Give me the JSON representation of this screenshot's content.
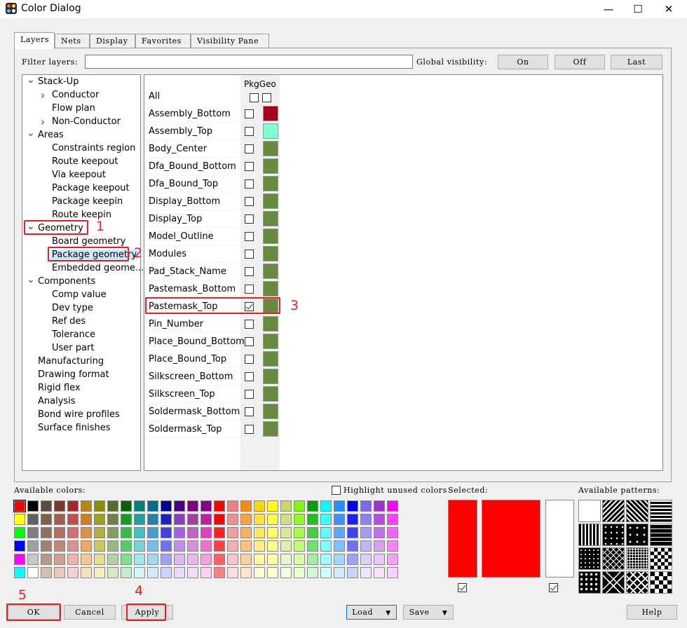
{
  "window": {
    "title": "Color Dialog",
    "min": "—",
    "max": "☐",
    "close": "✕"
  },
  "tabs": [
    "Layers",
    "Nets",
    "Display",
    "Favorites",
    "Visibility Pane"
  ],
  "filter": {
    "label": "Filter layers:",
    "value": ""
  },
  "global_visibility": {
    "label": "Global visibility:",
    "on": "On",
    "off": "Off",
    "last": "Last"
  },
  "tree": [
    {
      "label": "Stack-Up",
      "level": 0,
      "exp": "down"
    },
    {
      "label": "Conductor",
      "level": 1,
      "exp": "right"
    },
    {
      "label": "Flow plan",
      "level": 1,
      "exp": ""
    },
    {
      "label": "Non-Conductor",
      "level": 1,
      "exp": "right"
    },
    {
      "label": "Areas",
      "level": 0,
      "exp": "down"
    },
    {
      "label": "Constraints region",
      "level": 1,
      "exp": ""
    },
    {
      "label": "Route keepout",
      "level": 1,
      "exp": ""
    },
    {
      "label": "Via keepout",
      "level": 1,
      "exp": ""
    },
    {
      "label": "Package keepout",
      "level": 1,
      "exp": ""
    },
    {
      "label": "Package keepin",
      "level": 1,
      "exp": ""
    },
    {
      "label": "Route keepin",
      "level": 1,
      "exp": ""
    },
    {
      "label": "Geometry",
      "level": 0,
      "exp": "down"
    },
    {
      "label": "Board geometry",
      "level": 1,
      "exp": ""
    },
    {
      "label": "Package geometry",
      "level": 1,
      "exp": "",
      "selected": true
    },
    {
      "label": "Embedded geome...",
      "level": 1,
      "exp": ""
    },
    {
      "label": "Components",
      "level": 0,
      "exp": "down"
    },
    {
      "label": "Comp value",
      "level": 1,
      "exp": ""
    },
    {
      "label": "Dev type",
      "level": 1,
      "exp": ""
    },
    {
      "label": "Ref des",
      "level": 1,
      "exp": ""
    },
    {
      "label": "Tolerance",
      "level": 1,
      "exp": ""
    },
    {
      "label": "User part",
      "level": 1,
      "exp": ""
    },
    {
      "label": "Manufacturing",
      "level": 0,
      "exp": ""
    },
    {
      "label": "Drawing format",
      "level": 0,
      "exp": ""
    },
    {
      "label": "Rigid flex",
      "level": 0,
      "exp": ""
    },
    {
      "label": "Analysis",
      "level": 0,
      "exp": ""
    },
    {
      "label": "Bond wire profiles",
      "level": 0,
      "exp": ""
    },
    {
      "label": "Surface finishes",
      "level": 0,
      "exp": ""
    }
  ],
  "grid": {
    "column_header": "PkgGeo",
    "all_label": "All",
    "rows": [
      {
        "name": "Assembly_Bottom",
        "checked": false,
        "color": "#a8001a"
      },
      {
        "name": "Assembly_Top",
        "checked": false,
        "color": "#7fffd4"
      },
      {
        "name": "Body_Center",
        "checked": false,
        "color": "#668b3c"
      },
      {
        "name": "Dfa_Bound_Bottom",
        "checked": false,
        "color": "#668b3c"
      },
      {
        "name": "Dfa_Bound_Top",
        "checked": false,
        "color": "#668b3c"
      },
      {
        "name": "Display_Bottom",
        "checked": false,
        "color": "#668b3c"
      },
      {
        "name": "Display_Top",
        "checked": false,
        "color": "#668b3c"
      },
      {
        "name": "Model_Outline",
        "checked": false,
        "color": "#668b3c"
      },
      {
        "name": "Modules",
        "checked": false,
        "color": "#668b3c"
      },
      {
        "name": "Pad_Stack_Name",
        "checked": false,
        "color": "#668b3c"
      },
      {
        "name": "Pastemask_Bottom",
        "checked": false,
        "color": "#668b3c"
      },
      {
        "name": "Pastemask_Top",
        "checked": true,
        "color": "#668b3c"
      },
      {
        "name": "Pin_Number",
        "checked": false,
        "color": "#668b3c"
      },
      {
        "name": "Place_Bound_Bottom",
        "checked": false,
        "color": "#668b3c"
      },
      {
        "name": "Place_Bound_Top",
        "checked": false,
        "color": "#668b3c"
      },
      {
        "name": "Silkscreen_Bottom",
        "checked": false,
        "color": "#668b3c"
      },
      {
        "name": "Silkscreen_Top",
        "checked": false,
        "color": "#668b3c"
      },
      {
        "name": "Soldermask_Bottom",
        "checked": false,
        "color": "#668b3c"
      },
      {
        "name": "Soldermask_Top",
        "checked": false,
        "color": "#668b3c"
      }
    ]
  },
  "colors_section": {
    "available_label": "Available colors:",
    "highlight_label": "Highlight unused colors",
    "selected_label": "Selected:",
    "patterns_label": "Available patterns:",
    "selected_color": "#ff0000"
  },
  "palette": [
    [
      "#ff0000",
      "#000000",
      "#5a4a42",
      "#7a3a2a",
      "#a52a2a",
      "#b8860b",
      "#8b8b00",
      "#556b2f",
      "#006400",
      "#008080",
      "#006e8b",
      "#00008b",
      "#4b0082",
      "#800080",
      "#8b008b",
      "#ff0000",
      "#f08080",
      "#ff8c00",
      "#ffd700",
      "#ffff00",
      "#c8d86c",
      "#7cfc00",
      "#00a000",
      "#00ffff",
      "#1e90ff",
      "#0000ff",
      "#7b68ee",
      "#9932cc",
      "#ff00ff"
    ],
    [
      "#ffff00",
      "#606060",
      "#806048",
      "#a0604a",
      "#c0504a",
      "#d08020",
      "#a0a020",
      "#708040",
      "#10a020",
      "#20a0a0",
      "#2080b0",
      "#2020c0",
      "#8040c0",
      "#a040a0",
      "#c020a0",
      "#ff0000",
      "#f09090",
      "#ffa040",
      "#ffe040",
      "#ffff40",
      "#d0e080",
      "#90ff20",
      "#20c020",
      "#40ffff",
      "#4090ff",
      "#2020ff",
      "#9080f0",
      "#b050e0",
      "#ff40ff"
    ],
    [
      "#00ff00",
      "#808080",
      "#907060",
      "#b07060",
      "#d07070",
      "#e09040",
      "#b0b040",
      "#80a060",
      "#30c040",
      "#40c0c0",
      "#40a0d0",
      "#4040e0",
      "#a060e0",
      "#c060c0",
      "#e040c0",
      "#ff2020",
      "#f0a0a0",
      "#ffb060",
      "#ffe860",
      "#ffff60",
      "#d8e898",
      "#a8ff40",
      "#40d040",
      "#60ffff",
      "#60a8ff",
      "#4040ff",
      "#a898f0",
      "#c070e8",
      "#ff60ff"
    ],
    [
      "#0000ff",
      "#a0a0a0",
      "#a08070",
      "#c08878",
      "#e09090",
      "#f0a860",
      "#c8c860",
      "#98b880",
      "#50d060",
      "#70d8d8",
      "#70c0e8",
      "#7070f0",
      "#c090f0",
      "#d890d8",
      "#f070d0",
      "#ff4040",
      "#f0b0b0",
      "#ffc080",
      "#fff080",
      "#ffff80",
      "#e0f0b0",
      "#c0ff70",
      "#70e070",
      "#80ffff",
      "#80c0ff",
      "#7070ff",
      "#c0b8f8",
      "#d8a0f0",
      "#ff80ff"
    ],
    [
      "#ff00ff",
      "#c8c8c8",
      "#b89888",
      "#d0a090",
      "#f0b0b0",
      "#f8c890",
      "#e0e090",
      "#b8d0a8",
      "#80e090",
      "#a0e8e8",
      "#a0d8f0",
      "#a0a0f8",
      "#d8b8f8",
      "#e8b8e8",
      "#f8a0e0",
      "#ff6060",
      "#f8c8c8",
      "#ffd0a0",
      "#fff8a0",
      "#ffffa0",
      "#e8f8c8",
      "#d8ffa0",
      "#a0f0a0",
      "#a0ffff",
      "#a0d8ff",
      "#a0a0ff",
      "#d8d0f8",
      "#e8c8f8",
      "#ffa0ff"
    ],
    [
      "#00ffff",
      "#ffffff",
      "#d0c0b0",
      "#e8c8b8",
      "#f8d0d0",
      "#fce0c0",
      "#f0f0c0",
      "#d8e8c8",
      "#c0f0c8",
      "#d0f8f8",
      "#d0ecf8",
      "#d0d0fc",
      "#ecdcfc",
      "#f4dcf4",
      "#fcd0f0",
      "#ff8080",
      "#fce0e0",
      "#ffe8c8",
      "#fffcd0",
      "#ffffd0",
      "#f4fce4",
      "#ecffd0",
      "#d0f8d0",
      "#d0ffff",
      "#d0ecff",
      "#d0d0ff",
      "#ece8fc",
      "#f4e4fc",
      "#ffd0ff"
    ]
  ],
  "buttons": {
    "ok": "OK",
    "cancel": "Cancel",
    "apply": "Apply",
    "load": "Load",
    "save": "Save",
    "help": "Help",
    "dropdown_arrow": "▼"
  },
  "annotations": [
    "1",
    "2",
    "3",
    "4",
    "5"
  ]
}
